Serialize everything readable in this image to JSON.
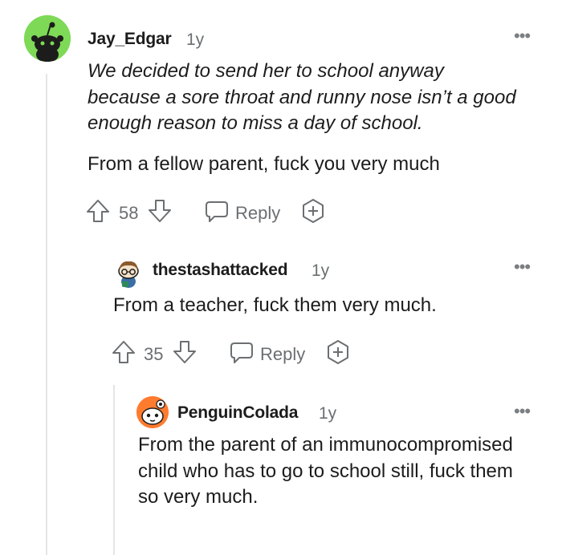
{
  "comments": [
    {
      "username": "Jay_Edgar",
      "age": "1y",
      "quote": "We decided to send her to school anyway because a sore throat and runny nose isn’t a good enough reason to miss a day of school.",
      "text": "From a fellow parent, fuck you very much",
      "votes": "58",
      "reply_label": "Reply",
      "avatar_color": "#7ed957"
    },
    {
      "username": "thestashattacked",
      "age": "1y",
      "text": "From a teacher, fuck them very much.",
      "votes": "35",
      "reply_label": "Reply"
    },
    {
      "username": "PenguinColada",
      "age": "1y",
      "text": "From the parent of an immunocompromised child who has to go to school still, fuck them so very much.",
      "avatar_color": "#ff7b2e"
    }
  ],
  "icons": {
    "more": "more-options-icon",
    "upvote": "upvote-arrow-icon",
    "downvote": "downvote-arrow-icon",
    "reply": "speech-bubble-icon",
    "award": "award-plus-icon"
  },
  "colors": {
    "text": "#1c1c1c",
    "meta": "#6b6f72",
    "rail": "#e3e5e6"
  }
}
